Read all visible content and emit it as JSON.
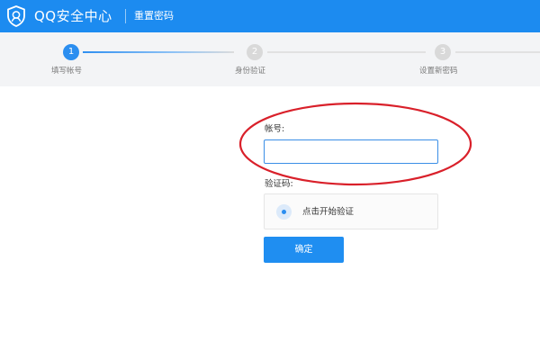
{
  "header": {
    "brand_name": "QQ安全中心",
    "page_name": "重置密码",
    "brand_icon": "shield-icon"
  },
  "steps": [
    {
      "number": "1",
      "label": "填写帐号",
      "state": "active"
    },
    {
      "number": "2",
      "label": "身份验证",
      "state": "inactive"
    },
    {
      "number": "3",
      "label": "设置新密码",
      "state": "inactive"
    }
  ],
  "form": {
    "account_label": "帐号:",
    "account_value": "",
    "captcha_label": "验证码:",
    "captcha_prompt": "点击开始验证",
    "confirm_label": "确定"
  },
  "colors": {
    "header_blue": "#1c8bf0",
    "primary_blue": "#2b8ef0",
    "annotation_red": "#d9202a"
  }
}
